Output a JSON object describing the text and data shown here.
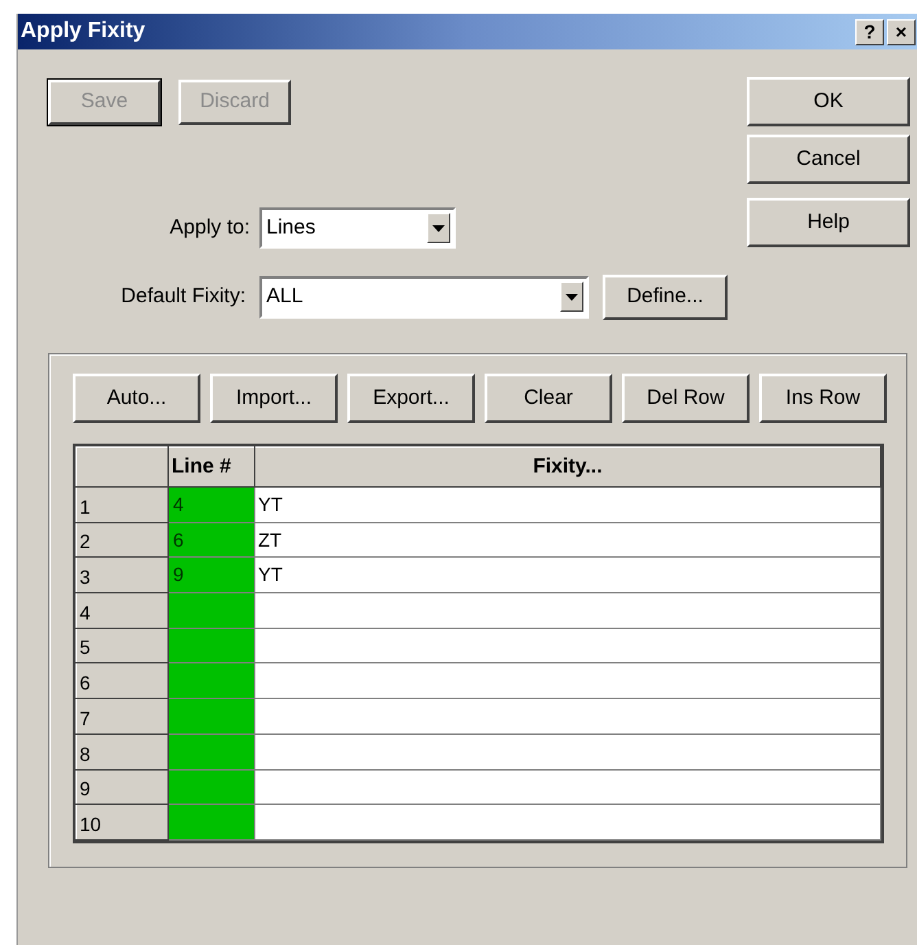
{
  "window": {
    "title": "Apply Fixity",
    "title_buttons": [
      "?",
      "×"
    ]
  },
  "top_buttons": [
    {
      "label": "Save",
      "disabled": true,
      "default": true
    },
    {
      "label": "Discard",
      "disabled": true,
      "default": false
    }
  ],
  "side_buttons": [
    "OK",
    "Cancel",
    "Help"
  ],
  "apply_to": {
    "label": "Apply to:",
    "value": "Lines"
  },
  "default_fixity": {
    "label": "Default Fixity:",
    "value": "ALL",
    "button": "Define..."
  },
  "toolbar": [
    "Auto...",
    "Import...",
    "Export...",
    "Clear",
    "Del Row",
    "Ins Row"
  ],
  "table": {
    "columns": [
      "Line #",
      "Fixity..."
    ],
    "rows": [
      {
        "header": "1",
        "line": "4",
        "fixity": "YT"
      },
      {
        "header": "2",
        "line": "6",
        "fixity": "ZT"
      },
      {
        "header": "3",
        "line": "9",
        "fixity": "YT"
      },
      {
        "header": "4"
      },
      {
        "header": "5"
      },
      {
        "header": "6"
      },
      {
        "header": "7"
      },
      {
        "header": "8"
      },
      {
        "header": "9"
      },
      {
        "header": "10"
      }
    ]
  }
}
